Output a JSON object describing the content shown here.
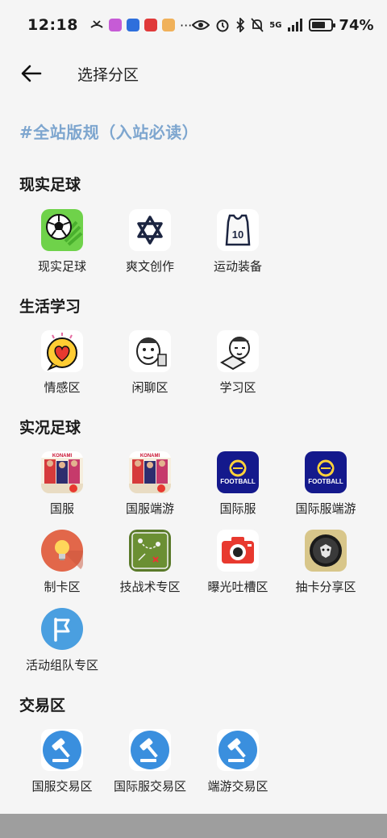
{
  "status_bar": {
    "time": "12:18",
    "battery_text": "74%",
    "battery_level": 0.74,
    "network_label": "5G"
  },
  "header": {
    "title": "选择分区"
  },
  "rules_link": "#全站版规（入站必读）",
  "sections": [
    {
      "title": "现实足球",
      "items": [
        {
          "label": "现实足球",
          "icon": "soccer-ball-icon"
        },
        {
          "label": "爽文创作",
          "icon": "star-of-david-icon"
        },
        {
          "label": "运动装备",
          "icon": "jersey-10-icon"
        }
      ]
    },
    {
      "title": "生活学习",
      "items": [
        {
          "label": "情感区",
          "icon": "heart-chat-icon"
        },
        {
          "label": "闲聊区",
          "icon": "meme-face-icon"
        },
        {
          "label": "学习区",
          "icon": "reading-meme-icon"
        }
      ]
    },
    {
      "title": "实况足球",
      "items": [
        {
          "label": "国服",
          "icon": "konami-cn-icon"
        },
        {
          "label": "国服端游",
          "icon": "konami-cn-pc-icon"
        },
        {
          "label": "国际服",
          "icon": "efootball-icon"
        },
        {
          "label": "国际服端游",
          "icon": "efootball-pc-icon"
        },
        {
          "label": "制卡区",
          "icon": "lightbulb-icon"
        },
        {
          "label": "技战术专区",
          "icon": "tactics-board-icon"
        },
        {
          "label": "曝光吐槽区",
          "icon": "camera-icon"
        },
        {
          "label": "抽卡分享区",
          "icon": "card-pack-icon"
        },
        {
          "label": "活动组队专区",
          "icon": "flag-icon"
        }
      ]
    },
    {
      "title": "交易区",
      "items": [
        {
          "label": "国服交易区",
          "icon": "gavel-icon"
        },
        {
          "label": "国际服交易区",
          "icon": "gavel-icon"
        },
        {
          "label": "端游交易区",
          "icon": "gavel-icon"
        }
      ]
    }
  ],
  "colors": {
    "rules_link": "#7ea6cf",
    "gavel_blue": "#3a8fde",
    "efootball_navy": "#14198c"
  }
}
